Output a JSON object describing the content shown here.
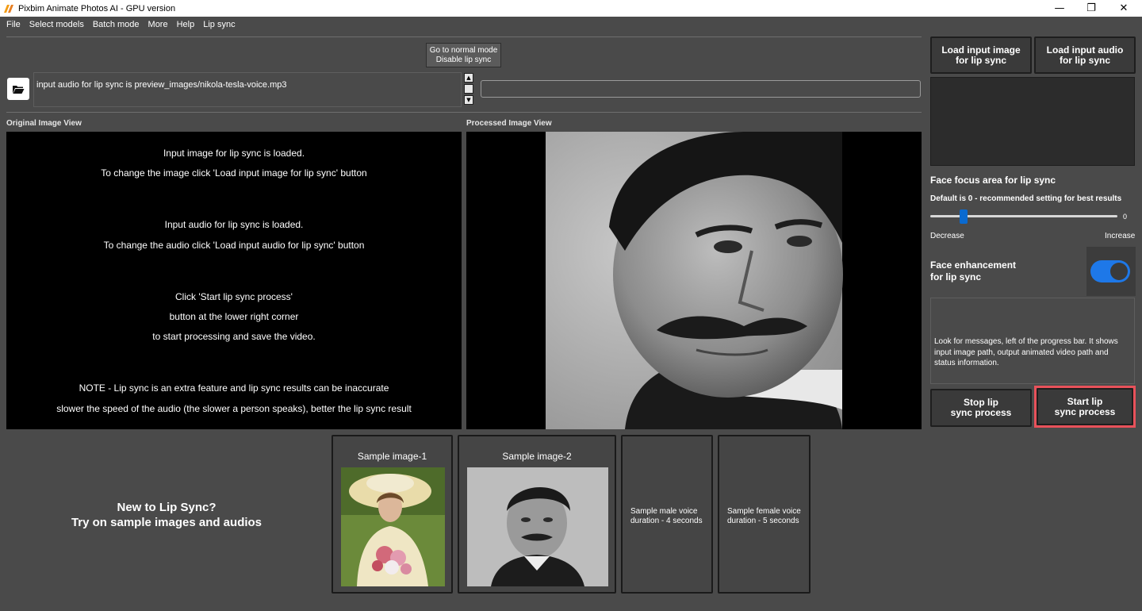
{
  "window": {
    "title": "Pixbim Animate Photos AI - GPU version",
    "controls": {
      "minimize": "—",
      "restore": "❐",
      "close": "✕"
    }
  },
  "menu": [
    "File",
    "Select models",
    "Batch mode",
    "More",
    "Help",
    "Lip sync"
  ],
  "mode_button": {
    "line1": "Go to normal mode",
    "line2": "Disable lip sync"
  },
  "message": "input audio for lip sync is preview_images/nikola-tesla-voice.mp3",
  "views": {
    "original_label": "Original Image View",
    "processed_label": "Processed Image View",
    "original_text": [
      "Input image for lip sync is loaded.",
      "To change the image click 'Load input image for lip sync' button",
      "Input audio for lip sync is loaded.",
      "To change the audio click 'Load input audio for lip sync' button",
      "Click 'Start lip sync process'",
      "button at the lower right corner",
      "to start processing and save the video.",
      "NOTE - Lip sync is an extra feature and lip sync results can be inaccurate",
      "slower the speed of the audio (the slower a person speaks), better the lip sync result"
    ]
  },
  "right_panel": {
    "load_image": {
      "line1": "Load input image",
      "line2": "for lip sync"
    },
    "load_audio": {
      "line1": "Load input audio",
      "line2": "for lip sync"
    },
    "face_focus_title": "Face focus area for lip sync",
    "face_focus_hint": "Default is 0 - recommended setting for best results",
    "slider_value": "0",
    "slider_fraction": 0.18,
    "decrease": "Decrease",
    "increase": "Increase",
    "face_enh_line1": "Face enhancement",
    "face_enh_line2": "for lip sync",
    "face_enh_on": true,
    "info": "Look for messages, left of the progress bar. It shows input image path, output animated video path and status information.",
    "stop": {
      "line1": "Stop lip",
      "line2": "sync process"
    },
    "start": {
      "line1": "Start lip",
      "line2": "sync process"
    }
  },
  "samples": {
    "intro_line1": "New to Lip Sync?",
    "intro_line2": "Try on sample images and audios",
    "image1": "Sample image-1",
    "image2": "Sample image-2",
    "male_voice": "Sample male voice duration - 4 seconds",
    "female_voice": "Sample female voice duration - 5 seconds"
  },
  "colors": {
    "background": "#4a4a4a",
    "toggle_on": "#1e78e8",
    "slider_thumb": "#0a6ad0",
    "highlight": "#e8515a"
  }
}
